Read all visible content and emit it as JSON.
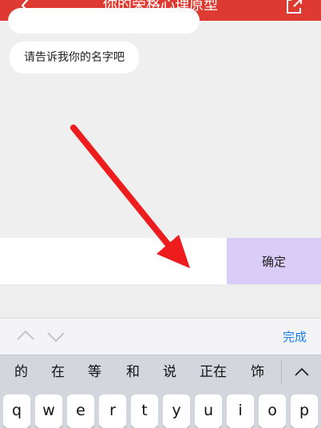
{
  "nav": {
    "title": "你的荣格心理原型"
  },
  "chat": {
    "ask_text": "请告诉我你的名字吧"
  },
  "input": {
    "value": "",
    "placeholder": "",
    "confirm_label": "确定"
  },
  "keyboard": {
    "done_label": "完成",
    "candidates": [
      "的",
      "在",
      "等",
      "和",
      "说",
      "正在",
      "饰"
    ],
    "keys": [
      "q",
      "w",
      "e",
      "r",
      "t",
      "y",
      "u",
      "i",
      "o",
      "p"
    ]
  },
  "colors": {
    "nav_bg": "#de3a31",
    "confirm_bg": "#d9ccf6",
    "done": "#1a7cf0",
    "annotation_arrow": "#ee1c1c"
  },
  "icons": {
    "back": "chevron-left-icon",
    "share": "share-icon",
    "prev": "chevron-up-icon",
    "next": "chevron-down-icon",
    "collapse": "chevron-up-icon"
  }
}
